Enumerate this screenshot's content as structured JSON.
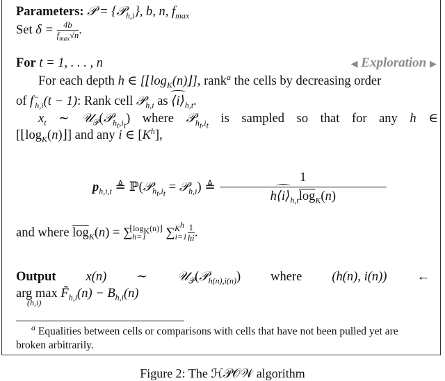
{
  "algorithm": {
    "parameters_label": "Parameters:",
    "parameters_value": "𝒫 = {𝒫h,i}, b, n, fmax",
    "set_delta": "Set δ = 4b / (fmax √n).",
    "set_label": "Set",
    "delta_eq": "δ =",
    "delta_num": "4b",
    "delta_den": "fmax√n",
    "for_label": "For",
    "for_range": "t = 1, . . . , n",
    "phase_label": "Exploration",
    "step1_line1_pre": "For each depth",
    "step1_line1_math": "h ∈ [⌊logK(n)⌋],",
    "step1_line1_post": "rank",
    "step1_footnote_mark": "a",
    "step1_line1_end": "the cells by decreasing order",
    "step1_line2_pre": "of",
    "step1_line2_math": "f⁻h,i(t − 1):",
    "step1_line2_post": "Rank cell 𝒫h,i as ⟨i⟩h,t.",
    "step2_line1": "xt ∼ 𝒰𝒫(𝒫ht,it) where 𝒫ht,it is sampled so that for any h ∈",
    "step2_line2": "[⌊logK(n)⌋] and any i ∈ [Kh],",
    "prob_lhs": "ph,i,t ≜ ℙ(𝒫ht,it = 𝒫h,i) ≜",
    "prob_num": "1",
    "prob_den": "h⟨i⟩h,t log̅K(n)",
    "and_where": "and where log̅K(n) = Σh=1..⌊logK(n)⌋ Σi=1..K^h 1/(hi).",
    "output_label": "Output",
    "output_line1": [
      "x(n)",
      "∼",
      "𝒰𝒫(𝒫h(n),i(n))",
      "where",
      "(h(n), i(n))",
      "←"
    ],
    "output_line2": "arg max F̃h,i(n) − Bh,i(n)",
    "output_argmax_sub": "(h,i)"
  },
  "footnote": {
    "mark": "a",
    "line1": "Equalities between cells or comparisons with cells that have not been pulled yet are",
    "line2": "broken arbitrarily."
  },
  "caption": "Figure 2:  The ℋ𝒫𝒪𝒲 algorithm"
}
